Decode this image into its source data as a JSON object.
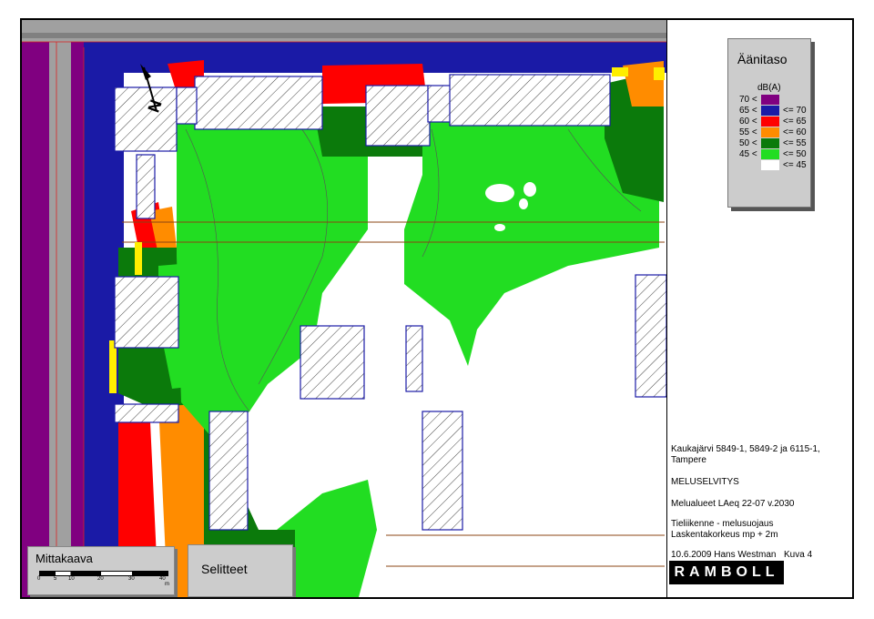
{
  "legend": {
    "title": "Äänitaso",
    "unit": "dB(A)",
    "rows": [
      {
        "low": "70 <",
        "color": "#800080",
        "high": ""
      },
      {
        "low": "65 <",
        "color": "#1a1aa6",
        "high": "<= 70"
      },
      {
        "low": "60 <",
        "color": "#ff0000",
        "high": "<= 65"
      },
      {
        "low": "55 <",
        "color": "#ff8c00",
        "high": "<= 60"
      },
      {
        "low": "50 <",
        "color": "#0b7a0b",
        "high": "<= 55"
      },
      {
        "low": "45 <",
        "color": "#22dd22",
        "high": "<= 50"
      },
      {
        "low": "",
        "color": "#ffffff",
        "high": "<= 45"
      }
    ]
  },
  "info": {
    "location": "Kaukajärvi 5849-1, 5849-2 ja 6115-1,",
    "city": "Tampere",
    "report": "MELUSELVITYS",
    "title": "Melualueet LAeq 22-07 v.2030",
    "scenario1": "Tieliikenne - melusuojaus",
    "scenario2": "Laskentakorkeus mp + 2m",
    "date_author": "10.6.2009  Hans Westman",
    "figure": "Kuva 4",
    "logo": "RAMBOLL"
  },
  "scale": {
    "label": "Mittakaava",
    "ticks": [
      "0",
      "5",
      "10",
      "20",
      "30",
      "40"
    ],
    "unit": "m"
  },
  "selitteet": "Selitteet",
  "north": "N",
  "colors": {
    "purple": "#800080",
    "blue": "#1a1aa6",
    "red": "#ff0000",
    "orange": "#ff8c00",
    "dark_green": "#0b7a0b",
    "green": "#22dd22",
    "yellow": "#ffee00",
    "road": "#a0a0a0"
  }
}
